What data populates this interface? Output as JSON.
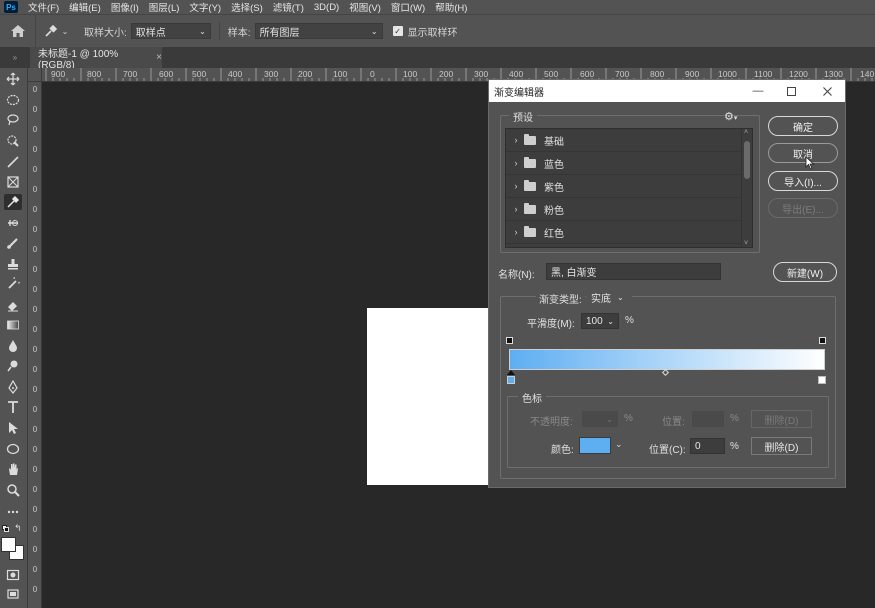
{
  "menu": {
    "app_logo": "Ps",
    "items": [
      "文件(F)",
      "编辑(E)",
      "图像(I)",
      "图层(L)",
      "文字(Y)",
      "选择(S)",
      "滤镜(T)",
      "3D(D)",
      "视图(V)",
      "窗口(W)",
      "帮助(H)"
    ]
  },
  "options": {
    "sample_size_label": "取样大小:",
    "sample_size_value": "取样点",
    "sample_label": "样本:",
    "sample_value": "所有图层",
    "show_ring_label": "显示取样环",
    "show_ring_checked": true
  },
  "tabs": {
    "document": "未标题-1 @ 100%(RGB/8)",
    "close": "×",
    "collapse": "»"
  },
  "ruler_top": [
    "900",
    "800",
    "700",
    "600",
    "500",
    "400",
    "300",
    "200",
    "100",
    "0",
    "100",
    "200",
    "300",
    "400",
    "500",
    "600",
    "700",
    "800",
    "900",
    "1000",
    "1100",
    "1200",
    "1300",
    "140"
  ],
  "ruler_left": [
    "0",
    "0",
    "0",
    "0",
    "0",
    "0",
    "0",
    "0",
    "0",
    "0",
    "0",
    "0",
    "0",
    "0",
    "0",
    "0",
    "0",
    "0",
    "0",
    "0",
    "0",
    "0",
    "0",
    "0",
    "0",
    "0"
  ],
  "dialog": {
    "title": "渐变编辑器",
    "presets_label": "预设",
    "presets": [
      "基础",
      "蓝色",
      "紫色",
      "粉色",
      "红色"
    ],
    "ok": "确定",
    "cancel": "取消",
    "import": "导入(I)...",
    "export": "导出(E)...",
    "name_label": "名称(N):",
    "name_value": "黑, 白渐变",
    "new_button": "新建(W)",
    "gradient_type_label": "渐变类型:",
    "gradient_type_value": "实底",
    "smoothness_label": "平滑度(M):",
    "smoothness_value": "100",
    "smoothness_unit": "%",
    "gradient_start_color": "#5eaef2",
    "gradient_end_color": "#ffffff",
    "color_stops_label": "色标",
    "opacity_label": "不透明度:",
    "opacity_unit": "%",
    "opacity_location_label": "位置:",
    "opacity_location_unit": "%",
    "opacity_delete": "删除(D)",
    "color_label": "颜色:",
    "color_swatch": "#5eaef2",
    "color_location_label": "位置(C):",
    "color_location_value": "0",
    "color_location_unit": "%",
    "color_delete": "删除(D)"
  }
}
